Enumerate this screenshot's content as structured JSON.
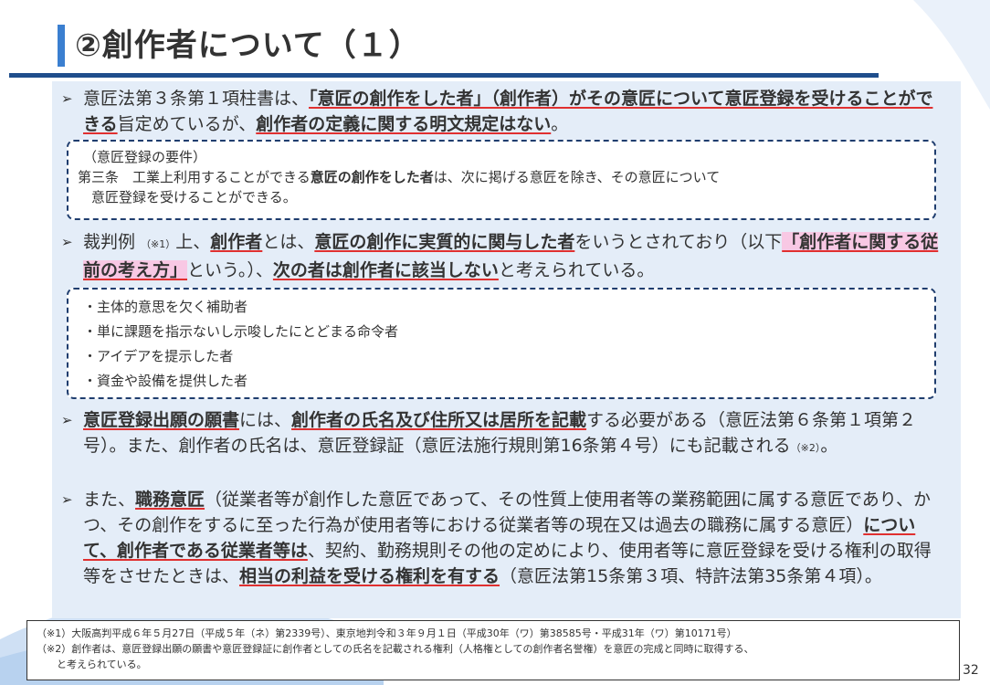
{
  "slide": {
    "title": "②創作者について（１）",
    "page_number": "32"
  },
  "para1": {
    "t1": "意匠法第３条第１項柱書は、",
    "t2": "「意匠の創作をした者」（創作者）がその意匠について意匠登録を受けることができる",
    "t3": "旨定めているが、",
    "t4": "創作者の定義に関する明文規定はない",
    "t5": "。"
  },
  "box1": {
    "line1": "（意匠登録の要件）",
    "line2a": "第三条　工業上利用することができる",
    "line2b": "意匠の創作をした者",
    "line2c": "は、次に掲げる意匠を除き、その意匠について",
    "line3": "　意匠登録を受けることができる。"
  },
  "para2": {
    "t1": "裁判例",
    "note": "（※1）",
    "t2": "上、",
    "t3": "創作者",
    "t4": "とは、",
    "t5": "意匠の創作に実質的に関与した者",
    "t6": "をいうとされており（以下",
    "t7": "「創作者に関する従前の考え方」",
    "t8": "という。）、",
    "t9": "次の者は創作者に該当しない",
    "t10": "と考えられている。"
  },
  "box2": {
    "items": [
      "・主体的意思を欠く補助者",
      "・単に課題を指示ないし示唆したにとどまる命令者",
      "・アイデアを提示した者",
      "・資金や設備を提供した者"
    ]
  },
  "para3": {
    "t1": "意匠登録出願の願書",
    "t2": "には、",
    "t3": "創作者の氏名及び住所又は居所を記載",
    "t4": "する必要がある（意匠法第６条第１項第２号）。また、創作者の氏名は、意匠登録証（意匠法施行規則第16条第４号）にも記載される",
    "note": "（※2）",
    "t5": "。"
  },
  "para4": {
    "t1": "また、",
    "t2": "職務意匠",
    "t3": "（従業者等が創作した意匠であって、その性質上使用者等の業務範囲に属する意匠であり、かつ、その創作をするに至った行為が使用者等における従業者等の現在又は過去の職務に属する意匠）",
    "t4": "について、創作者である従業者等は",
    "t5": "、契約、勤務規則その他の定めにより、使用者等に意匠登録を受ける権利の取得等をさせたときは、",
    "t6": "相当の利益を受ける権利を有する",
    "t7": "（意匠法第15条第３項、特許法第35条第４項）。"
  },
  "footer": {
    "note1": "（※1）大阪高判平成６年５月27日（平成５年（ネ）第2339号）、東京地判令和３年９月１日（平成30年（ワ）第38585号・平成31年（ワ）第10171号）",
    "note2": "（※2）創作者は、意匠登録出願の願書や意匠登録証に創作者としての氏名を記載される権利（人格権としての創作者名誉権）を意匠の完成と同時に取得する、",
    "note3": "　　と考えられている。"
  },
  "icons": {
    "bullet": "arrowhead-bullet-icon"
  },
  "colors": {
    "accent": "#3b7fd0",
    "rule": "#1f4e8c",
    "underline": "#e03030",
    "highlight": "#f8c8e4",
    "content_bg": "#e4edf8"
  }
}
